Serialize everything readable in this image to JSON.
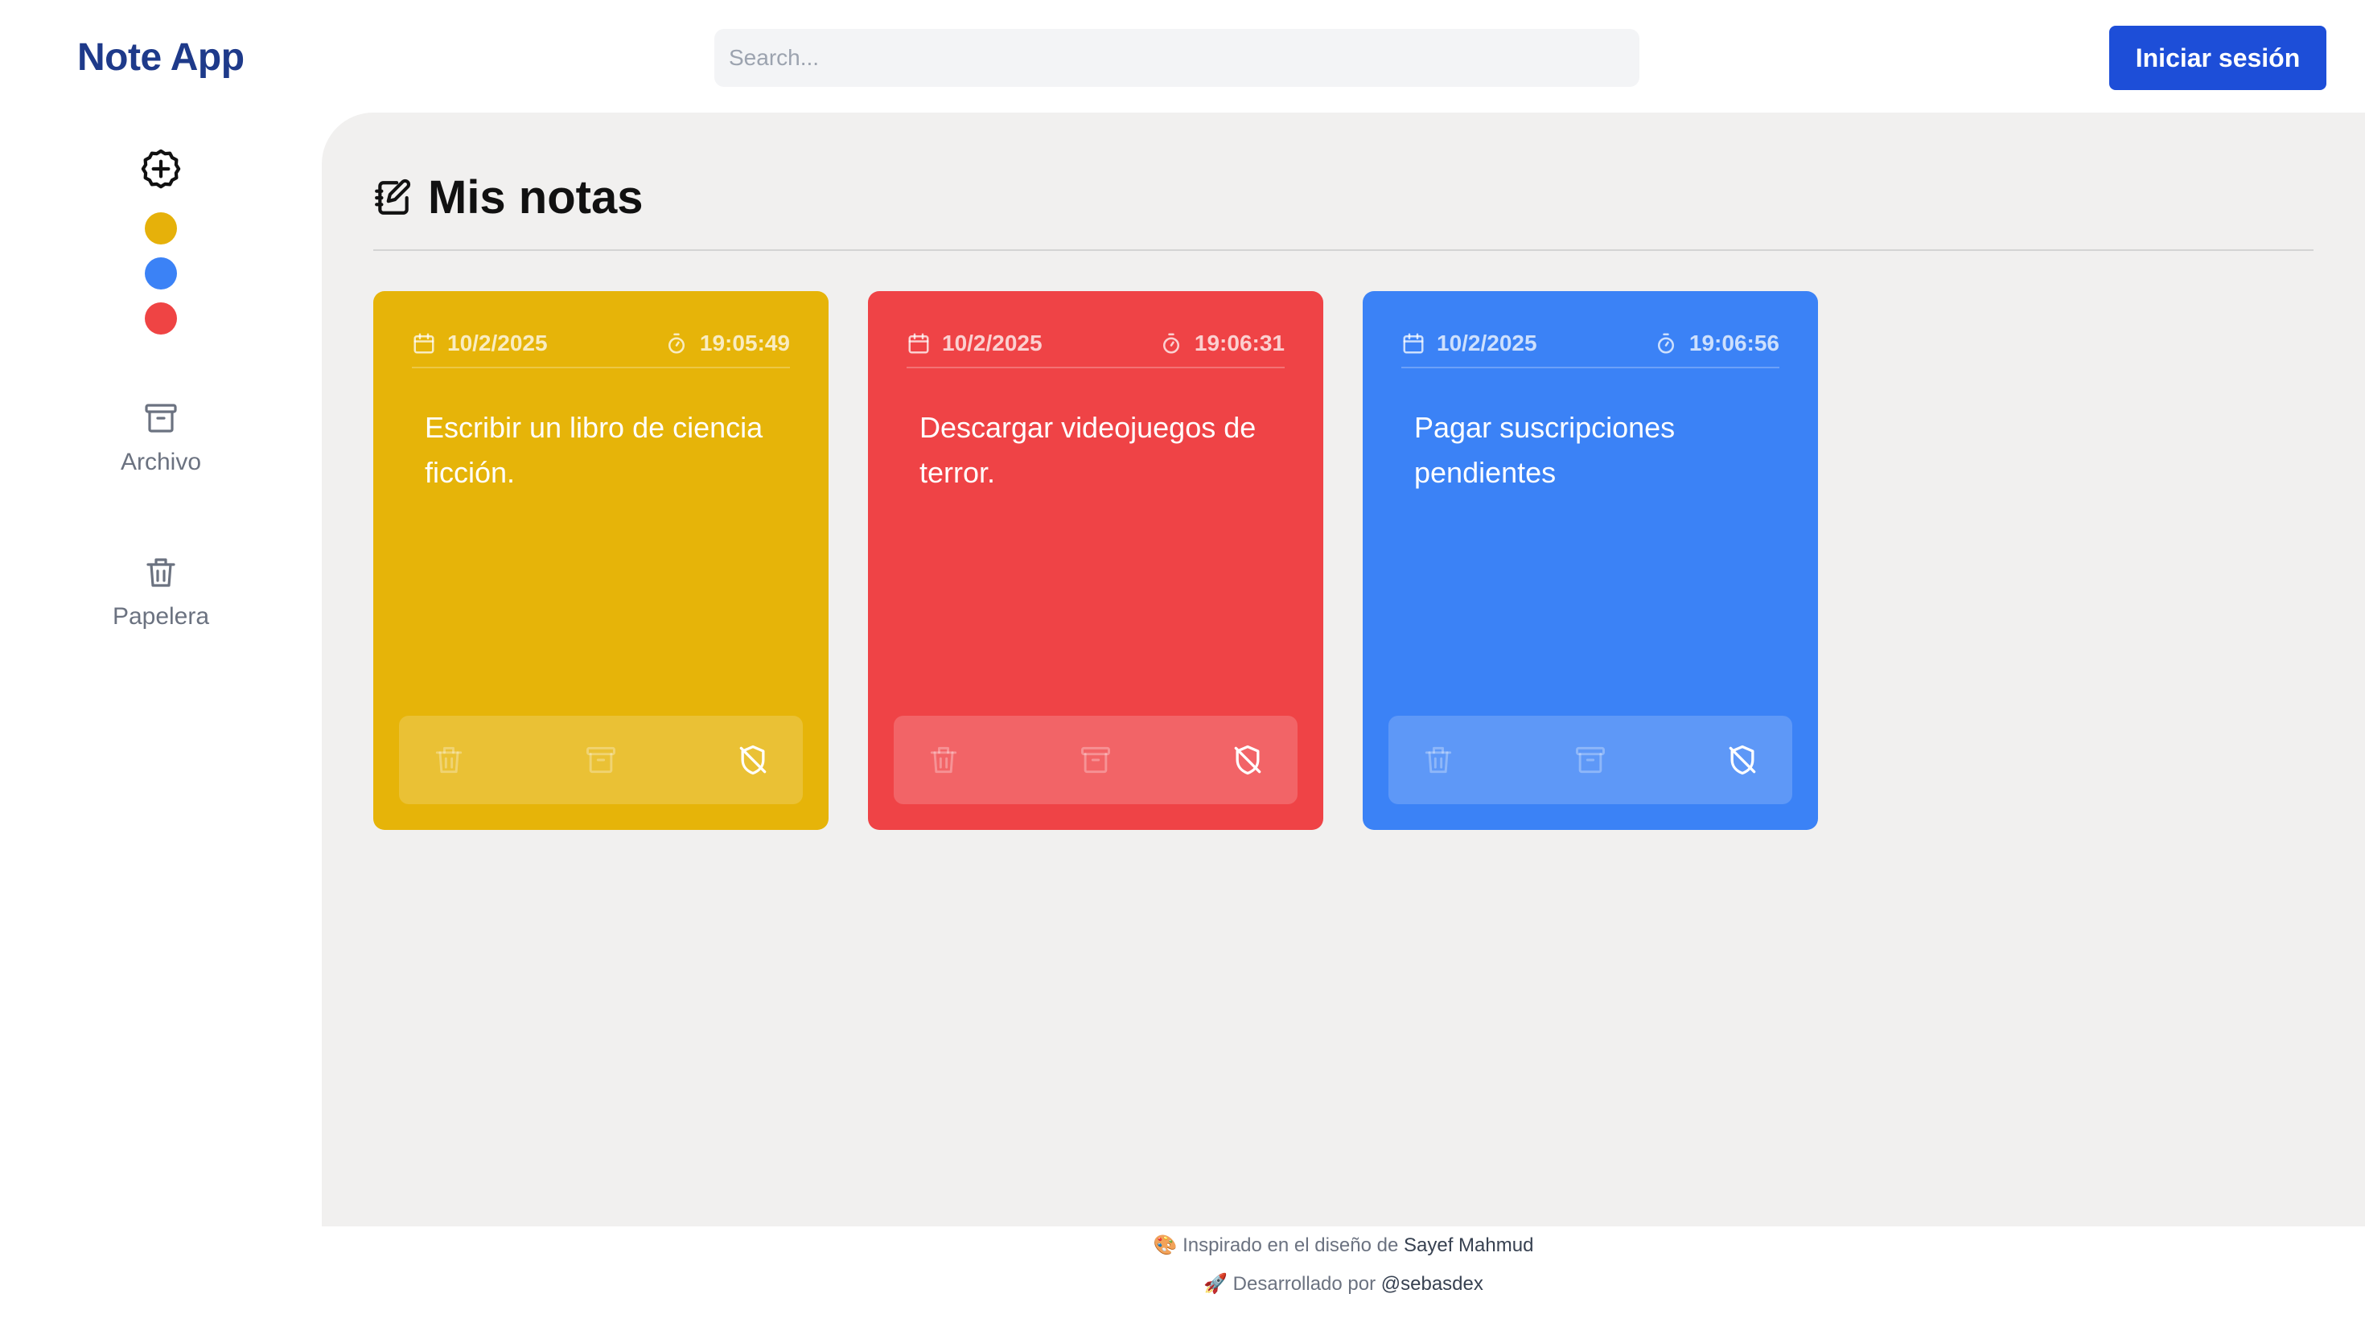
{
  "header": {
    "brand": "Note App",
    "search_placeholder": "Search...",
    "login_label": "Iniciar sesión"
  },
  "sidebar": {
    "color_dots": [
      {
        "name": "yellow",
        "color": "#e6b10a"
      },
      {
        "name": "blue",
        "color": "#3b82f6"
      },
      {
        "name": "red",
        "color": "#ef4444"
      }
    ],
    "archive_label": "Archivo",
    "trash_label": "Papelera"
  },
  "main": {
    "title": "Mis notas",
    "notes": [
      {
        "date": "10/2/2025",
        "time": "19:05:49",
        "text": "Escribir un libro de ciencia ficción.",
        "color": "#e6b409"
      },
      {
        "date": "10/2/2025",
        "time": "19:06:31",
        "text": "Descargar videojuegos de terror.",
        "color": "#ef4346"
      },
      {
        "date": "10/2/2025",
        "time": "19:06:56",
        "text": "Pagar suscripciones pendientes",
        "color": "#3b82f6"
      }
    ]
  },
  "footer": {
    "line1_prefix": "🎨 Inspirado en el diseño de ",
    "line1_name": "Sayef Mahmud",
    "line2_prefix": "🚀 Desarrollado por ",
    "line2_name": "@sebasdex"
  }
}
